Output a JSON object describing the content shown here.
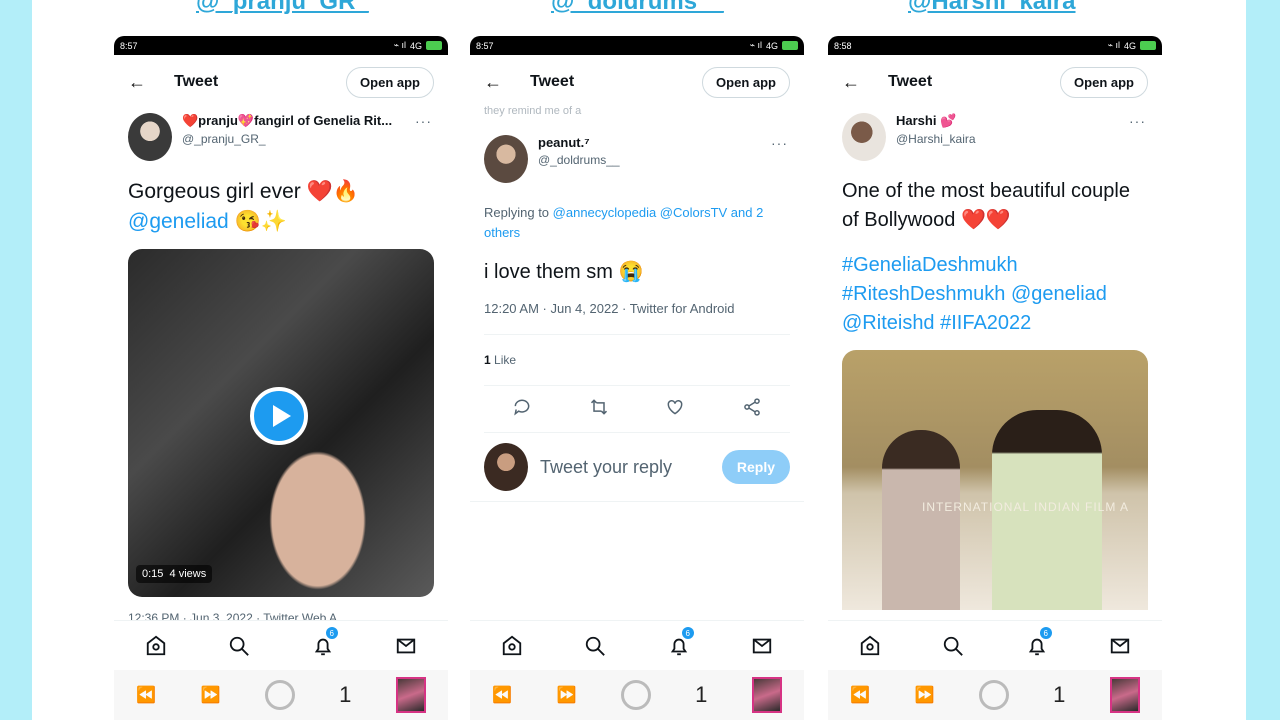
{
  "captions": [
    "@_pranju_GR_",
    "@_doldrums__",
    "@Harshi_kaira"
  ],
  "colors": {
    "accent": "#1d9bf0",
    "handle": "#2ea7d8",
    "side_bg": "#b3eef9"
  },
  "phones": [
    {
      "status_time": "8:57",
      "status_icons": "4G",
      "header_title": "Tweet",
      "open_app": "Open app",
      "display_name": "❤️pranju💖fangirl of Genelia Rit...",
      "username": "@_pranju_GR_",
      "more": "···",
      "text_line1": "Gorgeous girl ever ❤️🔥",
      "text_mention": "@geneliad",
      "text_emoji": " 😘✨",
      "video_duration": "0:15",
      "video_views": "4 views",
      "cutoff": "12:36 PM · Jun 3, 2022 · Twitter Web A...",
      "notif_count": "6",
      "sys_count": "1"
    },
    {
      "status_time": "8:57",
      "status_icons": "4G",
      "header_title": "Tweet",
      "open_app": "Open app",
      "ghost_text": "they remind me of a",
      "display_name": "peanut.⁷",
      "username": "@_doldrums__",
      "more": "···",
      "replying_prefix": "Replying to ",
      "replying_links": "@annecyclopedia @ColorsTV and 2 others",
      "text": "i love them sm 😭",
      "meta": "12:20 AM · Jun 4, 2022 · Twitter for Android",
      "like_count": "1",
      "like_label": " Like",
      "reply_placeholder": "Tweet your reply",
      "reply_button": "Reply",
      "notif_count": "6",
      "sys_count": "1"
    },
    {
      "status_time": "8:58",
      "status_icons": "4G",
      "header_title": "Tweet",
      "open_app": "Open app",
      "display_name": "Harshi 💕",
      "username": "@Harshi_kaira",
      "more": "···",
      "text": "One of the most beautiful couple of Bollywood ❤️❤️",
      "hashtags": "#GeneliaDeshmukh #RiteshDeshmukh @geneliad @Riteishd #IIFA2022",
      "photo_caption": "INTERNATIONAL INDIAN FILM A",
      "notif_count": "6",
      "sys_count": "1"
    }
  ]
}
